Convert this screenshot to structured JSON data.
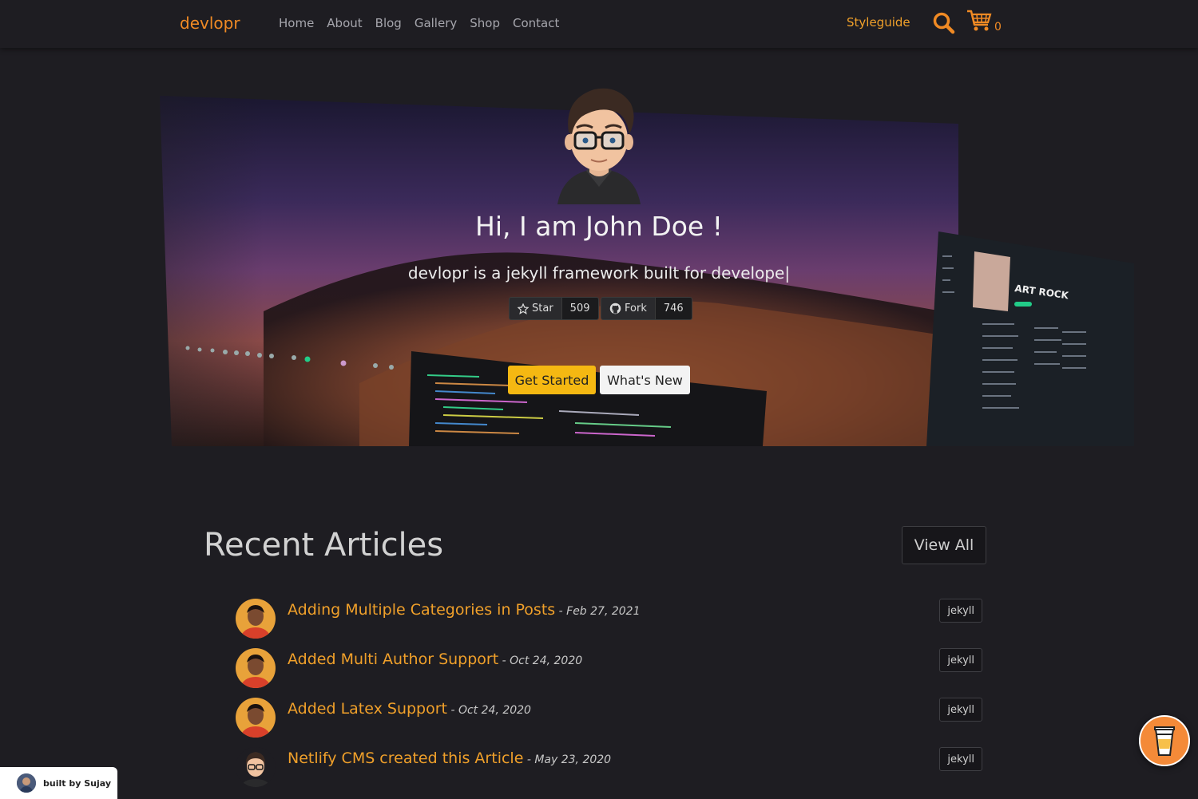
{
  "navbar": {
    "brand": "devlopr",
    "links": [
      "Home",
      "About",
      "Blog",
      "Gallery",
      "Shop",
      "Contact"
    ],
    "styleguide": "Styleguide",
    "cart_count": "0"
  },
  "hero": {
    "title": "Hi, I am John Doe !",
    "subtitle": "devlopr is a jekyll framework built for develope|",
    "star_label": "Star",
    "star_count": "509",
    "fork_label": "Fork",
    "fork_count": "746",
    "get_started": "Get Started",
    "whats_new": "What's New"
  },
  "articles": {
    "heading": "Recent Articles",
    "view_all": "View All",
    "items": [
      {
        "title": "Adding Multiple Categories in Posts",
        "date": " - Feb 27, 2021",
        "tag": "jekyll"
      },
      {
        "title": "Added Multi Author Support",
        "date": " - Oct 24, 2020",
        "tag": "jekyll"
      },
      {
        "title": "Added Latex Support",
        "date": " - Oct 24, 2020",
        "tag": "jekyll"
      },
      {
        "title": "Netlify CMS created this Article",
        "date": " - May 23, 2020",
        "tag": "jekyll"
      }
    ]
  },
  "footer_badge": {
    "text": "built by Sujay"
  },
  "colors": {
    "accent": "#f08a24",
    "link": "#f0a02a",
    "primary_button": "#f5b812",
    "background": "#1e1d22"
  }
}
